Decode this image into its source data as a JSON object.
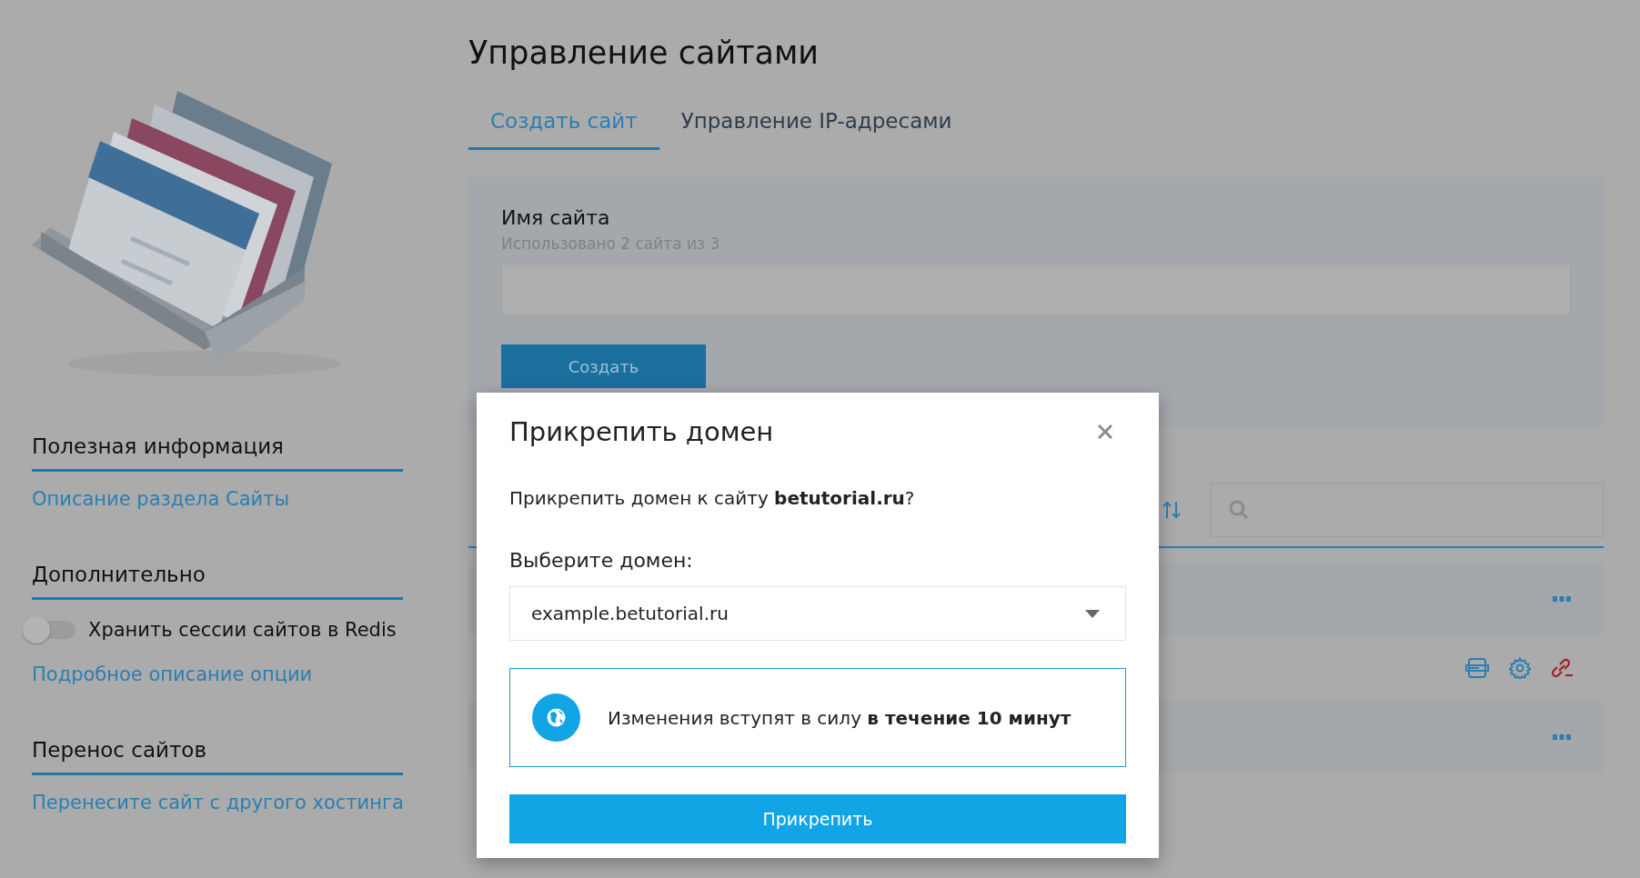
{
  "page_title": "Управление сайтами",
  "tabs": [
    {
      "label": "Создать сайт",
      "selected": true
    },
    {
      "label": "Управление IP-адресами",
      "selected": false
    }
  ],
  "create_form": {
    "label": "Имя сайта",
    "hint": "Использовано 2 сайта из 3",
    "button": "Создать"
  },
  "sidebar": {
    "sections": [
      {
        "title": "Полезная информация",
        "items": [
          {
            "kind": "link",
            "text": "Описание раздела Сайты"
          }
        ]
      },
      {
        "title": "Дополнительно",
        "items": [
          {
            "kind": "toggle",
            "text": "Хранить сессии сайтов в Redis",
            "on": false
          },
          {
            "kind": "link",
            "text": "Подробное описание опции"
          }
        ]
      },
      {
        "title": "Перенос сайтов",
        "items": [
          {
            "kind": "link",
            "text": "Перенесите сайт с другого хостинга"
          }
        ]
      }
    ]
  },
  "sites": {
    "rows": [
      {
        "kind": "menu"
      },
      {
        "kind": "actions"
      },
      {
        "kind": "menu"
      }
    ]
  },
  "modal": {
    "title": "Прикрепить домен",
    "question": "Прикрепить домен к сайту **betutorial.ru**?",
    "select_label": "Выберите домен:",
    "select_value": "example.betutorial.ru",
    "notice": "Изменения вступят в силу **в течение 10 минут**",
    "button": "Прикрепить"
  }
}
